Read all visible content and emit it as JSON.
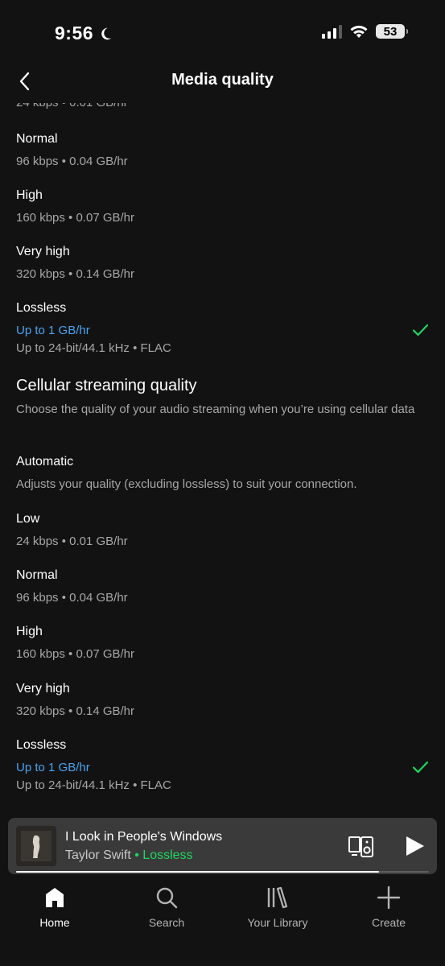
{
  "status": {
    "time": "9:56",
    "battery": "53"
  },
  "header": {
    "title": "Media quality"
  },
  "wifi_quality": {
    "low_sub_cut": "24 kbps • 0.01 GB/hr",
    "options": [
      {
        "label": "Normal",
        "detail": "96 kbps • 0.04 GB/hr"
      },
      {
        "label": "High",
        "detail": "160 kbps • 0.07 GB/hr"
      },
      {
        "label": "Very high",
        "detail": "320 kbps • 0.14 GB/hr"
      },
      {
        "label": "Lossless",
        "detail": "Up to 1 GB/hr",
        "detail2": "Up to 24-bit/44.1 kHz • FLAC",
        "selected": true
      }
    ]
  },
  "cellular_quality": {
    "title": "Cellular streaming quality",
    "description": "Choose the quality of your audio streaming when you’re using cellular data",
    "options": [
      {
        "label": "Automatic",
        "detail": "Adjusts your quality (excluding lossless) to suit your connection."
      },
      {
        "label": "Low",
        "detail": "24 kbps • 0.01 GB/hr"
      },
      {
        "label": "Normal",
        "detail": "96 kbps • 0.04 GB/hr"
      },
      {
        "label": "High",
        "detail": "160 kbps • 0.07 GB/hr"
      },
      {
        "label": "Very high",
        "detail": "320 kbps • 0.14 GB/hr"
      },
      {
        "label": "Lossless",
        "detail": "Up to 1 GB/hr",
        "detail2": "Up to 24-bit/44.1 kHz • FLAC",
        "selected": true
      }
    ]
  },
  "mini_player": {
    "track": "I Look in People's Windows",
    "artist": "Taylor Swift",
    "separator": " • ",
    "quality_badge": "Lossless",
    "progress_fraction": 0.88
  },
  "tabs": [
    {
      "label": "Home",
      "icon": "home-icon",
      "active": true
    },
    {
      "label": "Search",
      "icon": "search-icon"
    },
    {
      "label": "Your Library",
      "icon": "library-icon"
    },
    {
      "label": "Create",
      "icon": "plus-icon"
    }
  ],
  "colors": {
    "accent_green": "#1ed760",
    "link_blue": "#4aa3f0",
    "background": "#121212"
  }
}
